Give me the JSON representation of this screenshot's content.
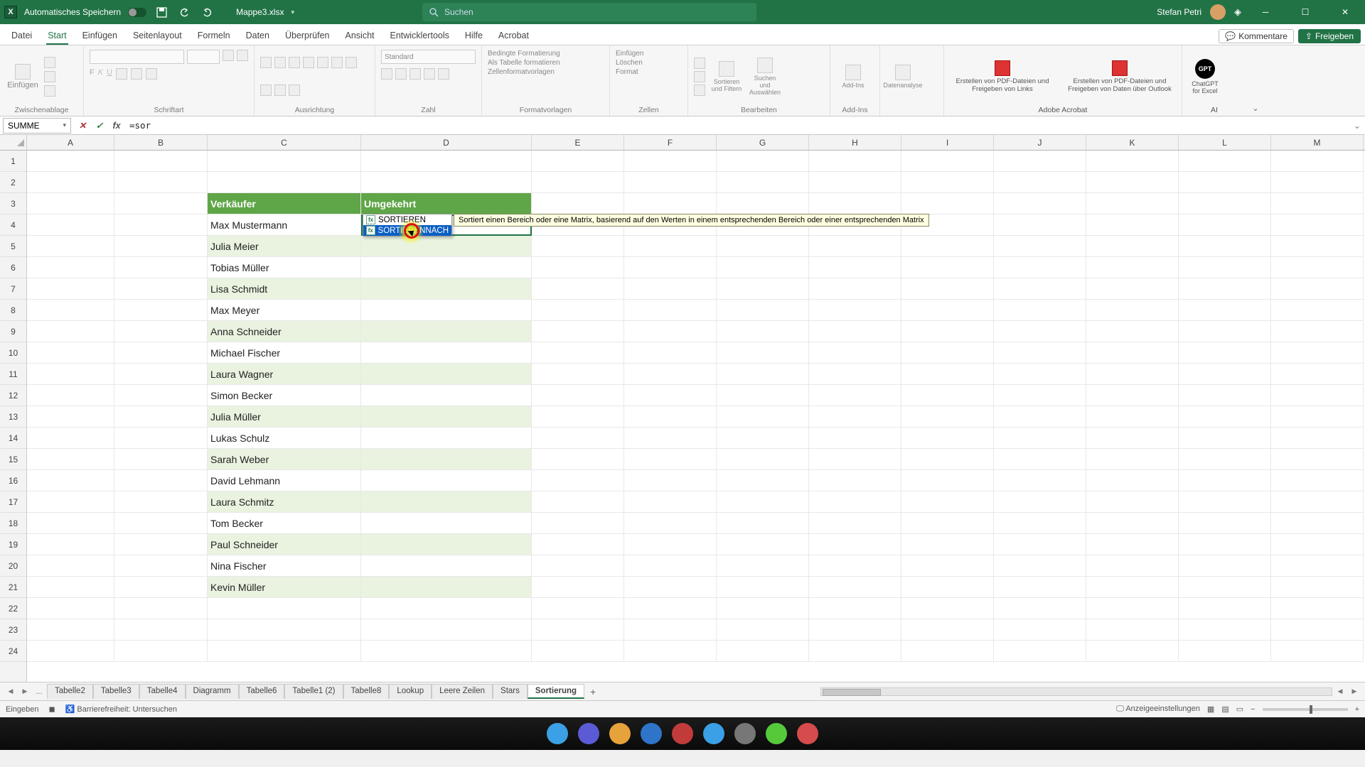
{
  "title": {
    "autosave_label": "Automatisches Speichern",
    "filename": "Mappe3.xlsx",
    "search_placeholder": "Suchen",
    "user": "Stefan Petri"
  },
  "menu": {
    "file": "Datei",
    "home": "Start",
    "insert": "Einfügen",
    "layout": "Seitenlayout",
    "formulas": "Formeln",
    "data": "Daten",
    "review": "Überprüfen",
    "view": "Ansicht",
    "dev": "Entwicklertools",
    "help": "Hilfe",
    "acrobat": "Acrobat",
    "comments": "Kommentare",
    "share": "Freigeben"
  },
  "ribbon": {
    "clipboard": {
      "paste": "Einfügen",
      "label": "Zwischenablage"
    },
    "font": {
      "label": "Schriftart"
    },
    "align": {
      "label": "Ausrichtung"
    },
    "number": {
      "format": "Standard",
      "label": "Zahl"
    },
    "styles": {
      "cond": "Bedingte Formatierung",
      "table": "Als Tabelle formatieren",
      "cell": "Zellenformatvorlagen",
      "label": "Formatvorlagen"
    },
    "cells": {
      "ins": "Einfügen",
      "del": "Löschen",
      "fmt": "Format",
      "label": "Zellen"
    },
    "editing": {
      "sort": "Sortieren und Filtern",
      "find": "Suchen und Auswählen",
      "label": "Bearbeiten"
    },
    "addins": {
      "btn": "Add-Ins",
      "label": "Add-Ins"
    },
    "analysis": {
      "btn": "Datenanalyse"
    },
    "acrobat": {
      "a": "Erstellen von PDF-Dateien und Freigeben von Links",
      "b": "Erstellen von PDF-Dateien und Freigeben von Daten über Outlook",
      "label": "Adobe Acrobat"
    },
    "ai": {
      "btn": "ChatGPT for Excel",
      "label": "AI"
    }
  },
  "fbar": {
    "name": "SUMME",
    "formula": "=sor"
  },
  "columns": [
    "A",
    "B",
    "C",
    "D",
    "E",
    "F",
    "G",
    "H",
    "I",
    "J",
    "K",
    "L",
    "M"
  ],
  "rownums": [
    "1",
    "2",
    "3",
    "4",
    "5",
    "6",
    "7",
    "8",
    "9",
    "10",
    "11",
    "12",
    "13",
    "14",
    "15",
    "16",
    "17",
    "18",
    "19",
    "20",
    "21",
    "22",
    "23",
    "24"
  ],
  "grid": {
    "header_c": "Verkäufer",
    "header_d": "Umgekehrt",
    "editing_value": "=sor",
    "names": [
      "Max Mustermann",
      "Julia Meier",
      "Tobias Müller",
      "Lisa Schmidt",
      "Max Meyer",
      "Anna Schneider",
      "Michael Fischer",
      "Laura Wagner",
      "Simon Becker",
      "Julia Müller",
      "Lukas Schulz",
      "Sarah Weber",
      "David Lehmann",
      "Laura Schmitz",
      "Tom Becker",
      "Paul Schneider",
      "Nina Fischer",
      "Kevin Müller"
    ]
  },
  "autocomplete": {
    "items": [
      {
        "label": "SORTIEREN"
      },
      {
        "label": "SORTIERENNACH"
      }
    ],
    "selected": 1,
    "tooltip": "Sortiert einen Bereich oder eine Matrix, basierend auf den Werten in einem entsprechenden Bereich oder einer entsprechenden Matrix"
  },
  "sheets": {
    "list": [
      "Tabelle2",
      "Tabelle3",
      "Tabelle4",
      "Diagramm",
      "Tabelle6",
      "Tabelle1 (2)",
      "Tabelle8",
      "Lookup",
      "Leere Zeilen",
      "Stars",
      "Sortierung"
    ],
    "active": "Sortierung",
    "more": "...",
    "add": "+"
  },
  "status": {
    "mode": "Eingeben",
    "acc": "Barrierefreiheit: Untersuchen",
    "display": "Anzeigeeinstellungen"
  }
}
